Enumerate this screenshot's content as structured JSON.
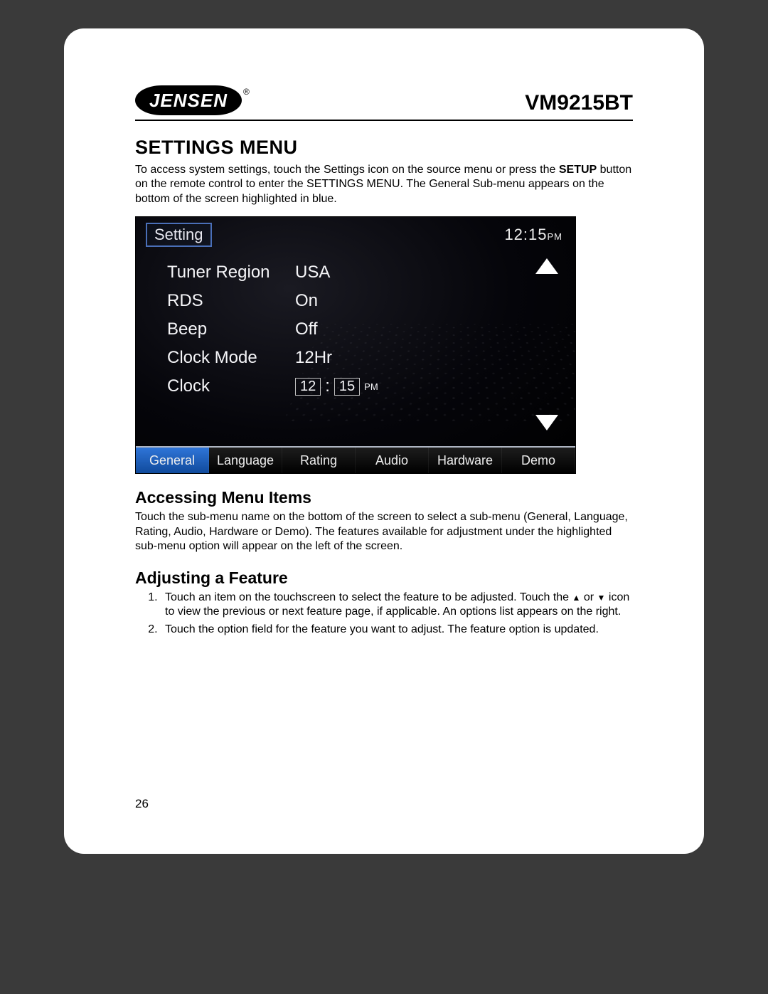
{
  "brand": "JENSEN",
  "model": "VM9215BT",
  "section_title": "SETTINGS MENU",
  "intro_a": "To access system settings, touch the Settings icon on the source menu or press the ",
  "intro_bold": "SETUP",
  "intro_b": " button on the remote control to enter the SETTINGS MENU. The General Sub-menu appears on the bottom of the screen highlighted in blue.",
  "device": {
    "title_button": "Setting",
    "clock_time": "12:15",
    "clock_ampm": "PM",
    "rows": [
      {
        "label": "Tuner Region",
        "value": "USA"
      },
      {
        "label": "RDS",
        "value": "On"
      },
      {
        "label": "Beep",
        "value": "Off"
      },
      {
        "label": "Clock Mode",
        "value": "12Hr"
      }
    ],
    "clock_row_label": "Clock",
    "clock_row": {
      "hh": "12",
      "mm": "15",
      "ampm": "PM"
    },
    "tabs": [
      "General",
      "Language",
      "Rating",
      "Audio",
      "Hardware",
      "Demo"
    ],
    "active_tab": "General"
  },
  "sub1_title": "Accessing Menu Items",
  "sub1_text": "Touch the sub-menu name on the bottom of the screen to select a sub-menu (General, Language, Rating, Audio, Hardware or Demo). The features available for adjustment under the highlighted sub-menu option will appear on the left of the screen.",
  "sub2_title": "Adjusting a Feature",
  "step1_a": "Touch an item on the touchscreen to select the feature to be adjusted. Touch the ",
  "step1_b": " or ",
  "step1_c": " icon to view the previous or next feature page, if applicable. An options list appears on the right.",
  "step2": "Touch the option field for the feature you want to adjust. The feature option is updated.",
  "page_number": "26"
}
